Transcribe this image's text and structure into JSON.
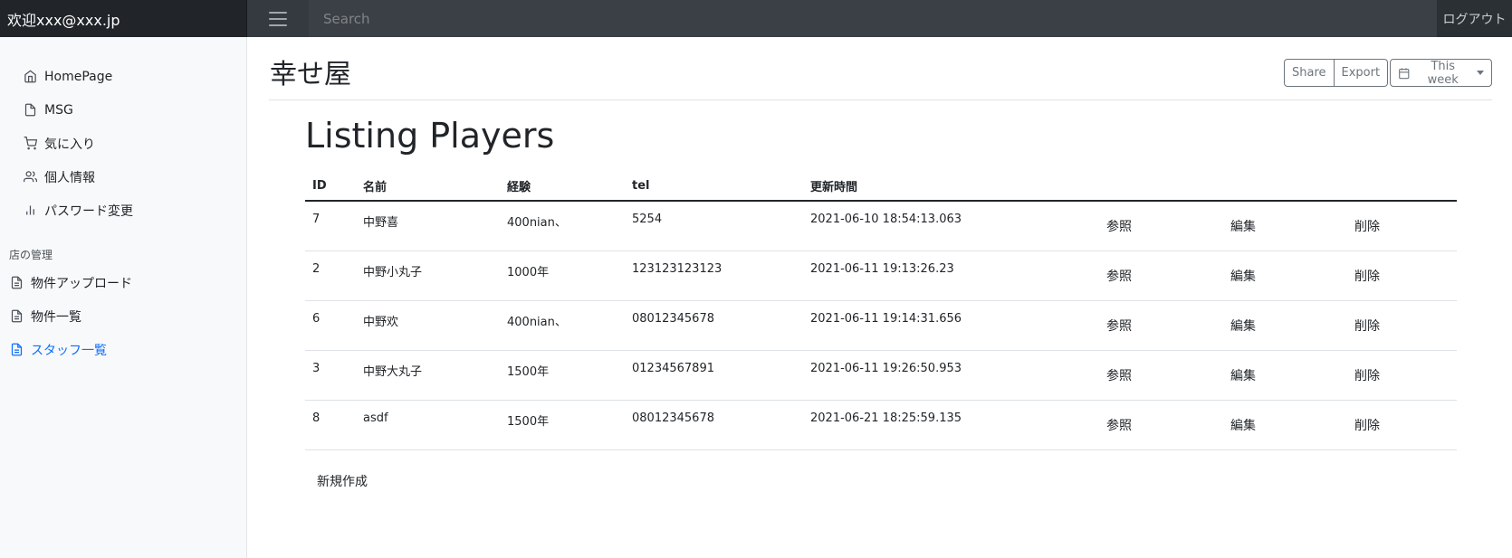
{
  "navbar": {
    "brand": "欢迎xxx@xxx.jp",
    "search_placeholder": "Search",
    "logout": "ログアウト"
  },
  "sidebar": {
    "main_items": [
      {
        "label": "HomePage",
        "icon": "home-icon"
      },
      {
        "label": "MSG",
        "icon": "file-icon"
      },
      {
        "label": "気に入り",
        "icon": "cart-icon"
      },
      {
        "label": "個人情報",
        "icon": "users-icon"
      },
      {
        "label": "パスワード変更",
        "icon": "bar-chart-icon"
      }
    ],
    "section_heading": "店の管理",
    "sub_items": [
      {
        "label": "物件アップロード",
        "icon": "file-text-icon"
      },
      {
        "label": "物件一覧",
        "icon": "file-text-icon"
      },
      {
        "label": "スタッフ一覧",
        "icon": "file-text-icon",
        "active": true
      }
    ],
    "active_color": "#0d6efd"
  },
  "header": {
    "title": "幸せ屋",
    "share": "Share",
    "export": "Export",
    "week": "This week"
  },
  "listing": {
    "title": "Listing Players",
    "columns": [
      "ID",
      "名前",
      "経験",
      "tel",
      "更新時間"
    ],
    "actions": {
      "view": "参照",
      "edit": "編集",
      "delete": "削除"
    },
    "rows": [
      {
        "id": "7",
        "name": "中野喜",
        "exp": "400nian、",
        "tel": "5254",
        "updated": "2021-06-10 18:54:13.063"
      },
      {
        "id": "2",
        "name": "中野小丸子",
        "exp": "1000年",
        "tel": "123123123123",
        "updated": "2021-06-11 19:13:26.23"
      },
      {
        "id": "6",
        "name": "中野欢",
        "exp": "400nian、",
        "tel": "08012345678",
        "updated": "2021-06-11 19:14:31.656"
      },
      {
        "id": "3",
        "name": "中野大丸子",
        "exp": "1500年",
        "tel": "01234567891",
        "updated": "2021-06-11 19:26:50.953"
      },
      {
        "id": "8",
        "name": "asdf",
        "exp": "1500年",
        "tel": "08012345678",
        "updated": "2021-06-21 18:25:59.135"
      }
    ],
    "new_link": "新規作成"
  }
}
